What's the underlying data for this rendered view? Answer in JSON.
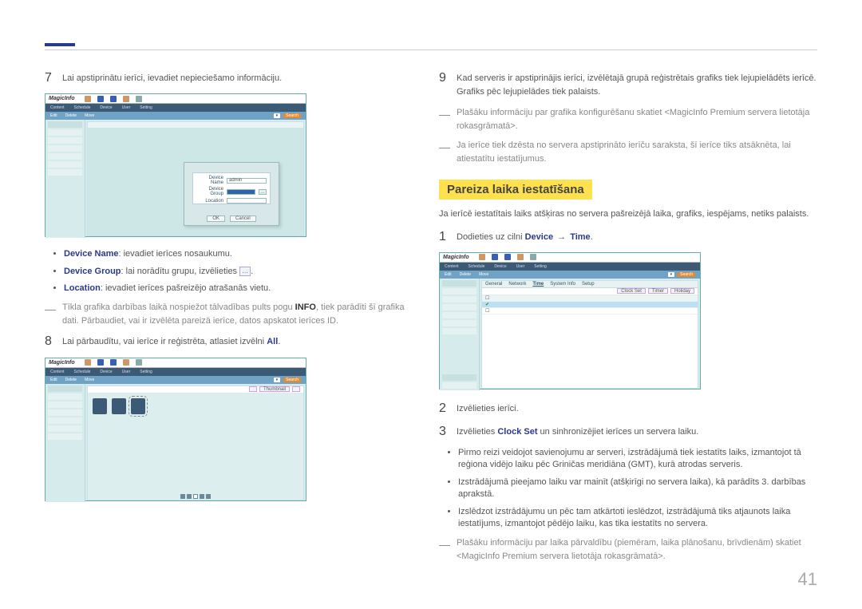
{
  "page_number": "41",
  "left": {
    "step7_num": "7",
    "step7_text": "Lai apstiprinātu ierīci, ievadiet nepieciešamo informāciju.",
    "bullets": {
      "device_name_term": "Device Name",
      "device_name_text": ": ievadiet ierīces nosaukumu.",
      "device_group_term": "Device Group",
      "device_group_text": ": lai norādītu grupu, izvēlieties ",
      "device_group_after": ".",
      "location_term": "Location",
      "location_text": ": ievadiet ierīces pašreizējo atrašanās vietu."
    },
    "note1_pre": "Tīkla grafika darbības laikā nospiežot tālvadības pults pogu ",
    "note1_bold": "INFO",
    "note1_post": ", tiek parādīti šī grafika dati. Pārbaudiet, vai ir izvēlēta pareizā ierīce, datos apskatot ierīces ID.",
    "step8_num": "8",
    "step8_pre": "Lai pārbaudītu, vai ierīce ir reģistrēta, atlasiet izvēlni ",
    "step8_bold": "All",
    "step8_post": "."
  },
  "right": {
    "step9_num": "9",
    "step9_text": "Kad serveris ir apstiprinājis ierīci, izvēlētajā grupā reģistrētais grafiks tiek lejupielādēts ierīcē. Grafiks pēc lejupielādes tiek palaists.",
    "note_a": "Plašāku informāciju par grafika konfigurēšanu skatiet <MagicInfo Premium servera lietotāja rokasgrāmatā>.",
    "note_b": "Ja ierīce tiek dzēsta no servera apstiprināto ierīču saraksta, šī ierīce tiks atsāknēta, lai atiestatītu iestatījumus.",
    "section_title": "Pareiza laika iestatīšana",
    "intro": "Ja ierīcē iestatītais laiks atšķiras no servera pašreizējā laika, grafiks, iespējams, netiks palaists.",
    "step1_num": "1",
    "step1_pre": "Dodieties uz cilni ",
    "step1_b1": "Device",
    "step1_arrow": " → ",
    "step1_b2": "Time",
    "step1_post": ".",
    "step2_num": "2",
    "step2_text": "Izvēlieties ierīci.",
    "step3_num": "3",
    "step3_pre": "Izvēlieties ",
    "step3_bold": "Clock Set",
    "step3_post": " un sinhronizējiet ierīces un servera laiku.",
    "bullets": {
      "b1": "Pirmo reizi veidojot savienojumu ar serveri, izstrādājumā tiek iestatīts laiks, izmantojot tā reģiona vidējo laiku pēc Griničas meridiāna (GMT), kurā atrodas serveris.",
      "b2": "Izstrādājumā pieejamo laiku var mainīt (atšķirīgi no servera laika), kā parādīts 3. darbības aprakstā.",
      "b3": "Izslēdzot izstrādājumu un pēc tam atkārtoti ieslēdzot, izstrādājumā tiks atjaunots laika iestatījums, izmantojot pēdējo laiku, kas tika iestatīts no servera."
    },
    "note_c": "Plašāku informāciju par laika pārvaldību (piemēram, laika plānošanu, brīvdienām) skatiet <MagicInfo Premium servera lietotāja rokasgrāmatā>."
  },
  "ss": {
    "logo": "MagicInfo",
    "menu": [
      "Content",
      "Schedule",
      "Device",
      "User",
      "Setting"
    ],
    "dlg_rows": [
      {
        "label": "Device Name",
        "value": "admin",
        "sel": false,
        "ell": false
      },
      {
        "label": "Device Group",
        "value": "",
        "sel": true,
        "ell": true
      },
      {
        "label": "Location",
        "value": "",
        "sel": false,
        "ell": false
      }
    ],
    "ok": "OK",
    "cancel": "Cancel",
    "tabs": [
      "General",
      "Network",
      "Time",
      "System Info",
      "Setup"
    ],
    "subbtns": [
      "Clock Set",
      "Timer",
      "Holiday"
    ],
    "search": "Search",
    "icon_ell": "…"
  }
}
